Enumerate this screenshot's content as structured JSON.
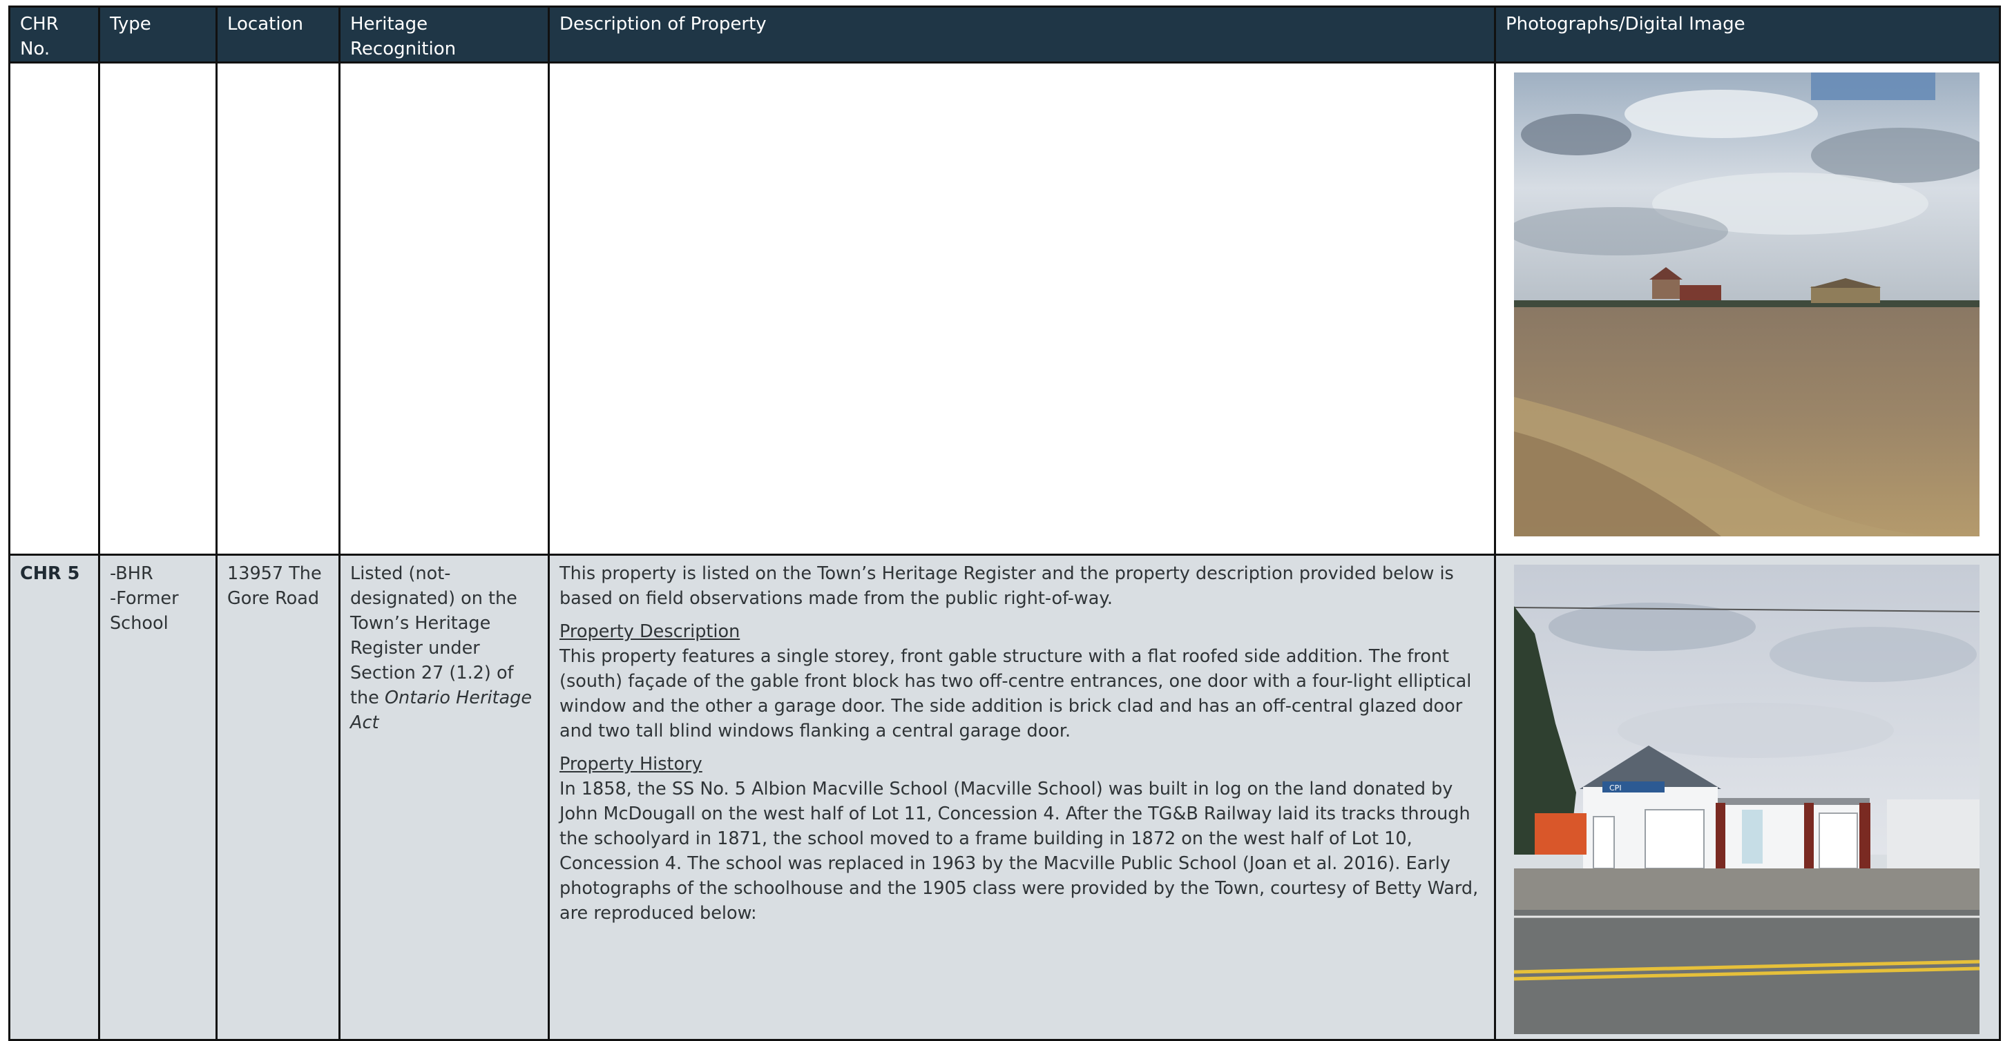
{
  "header": {
    "chr_no": "CHR No.",
    "type": "Type",
    "location": "Location",
    "heritage_recognition": "Heritage Recognition",
    "description": "Description of Property",
    "photographs": "Photographs/Digital Image"
  },
  "rows": [
    {
      "chr_no": "",
      "type": "",
      "location": "",
      "heritage_recognition": "",
      "description": "",
      "photo_icon": "farm-field-photo"
    },
    {
      "chr_no": "CHR 5",
      "type_lines": [
        "-BHR",
        "-Former School"
      ],
      "location": "13957 The Gore Road",
      "heritage_recognition_plain": "Listed (not-designated) on the Town’s Heritage Register under Section 27 (1.2) of the ",
      "heritage_recognition_italic": "Ontario Heritage Act",
      "intro": "This property is listed on the Town’s Heritage Register and the property description provided below is based on field observations made from the public right-of-way.",
      "property_description_heading": "Property Description",
      "property_description": "This property features a single storey, front gable structure with a flat roofed side addition. The front (south) façade of the gable front block has two off-centre entrances, one door with a four-light elliptical window and the other a garage door. The side addition is brick clad and has an off-central glazed door and two tall blind windows flanking a central garage door.",
      "property_history_heading": "Property History",
      "property_history": "In 1858, the SS No. 5 Albion Macville School (Macville School) was built in log on the land donated by John McDougall on the west half of Lot 11, Concession 4. After the TG&B Railway laid its tracks through the schoolyard in 1871, the school moved to a frame building in 1872 on the west half of Lot 10, Concession 4. The school was replaced in 1963 by the Macville Public School (Joan et al. 2016). Early photographs of the schoolhouse and the 1905 class were provided by the Town, courtesy of Betty Ward, are reproduced below:",
      "photo_icon": "school-building-photo",
      "photo_sign_text": "CPI"
    }
  ],
  "colors": {
    "header_bg": "#1f3646",
    "row_shade": "#d9dee2",
    "text": "#2f3437"
  }
}
